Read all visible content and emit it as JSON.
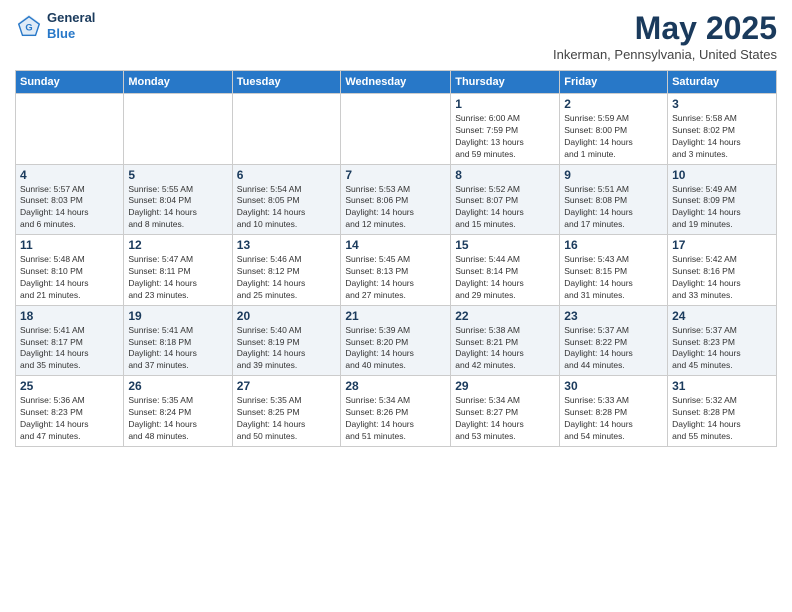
{
  "header": {
    "logo_line1": "General",
    "logo_line2": "Blue",
    "month_title": "May 2025",
    "location": "Inkerman, Pennsylvania, United States"
  },
  "days_of_week": [
    "Sunday",
    "Monday",
    "Tuesday",
    "Wednesday",
    "Thursday",
    "Friday",
    "Saturday"
  ],
  "weeks": [
    [
      {
        "day": "",
        "info": ""
      },
      {
        "day": "",
        "info": ""
      },
      {
        "day": "",
        "info": ""
      },
      {
        "day": "",
        "info": ""
      },
      {
        "day": "1",
        "info": "Sunrise: 6:00 AM\nSunset: 7:59 PM\nDaylight: 13 hours\nand 59 minutes."
      },
      {
        "day": "2",
        "info": "Sunrise: 5:59 AM\nSunset: 8:00 PM\nDaylight: 14 hours\nand 1 minute."
      },
      {
        "day": "3",
        "info": "Sunrise: 5:58 AM\nSunset: 8:02 PM\nDaylight: 14 hours\nand 3 minutes."
      }
    ],
    [
      {
        "day": "4",
        "info": "Sunrise: 5:57 AM\nSunset: 8:03 PM\nDaylight: 14 hours\nand 6 minutes."
      },
      {
        "day": "5",
        "info": "Sunrise: 5:55 AM\nSunset: 8:04 PM\nDaylight: 14 hours\nand 8 minutes."
      },
      {
        "day": "6",
        "info": "Sunrise: 5:54 AM\nSunset: 8:05 PM\nDaylight: 14 hours\nand 10 minutes."
      },
      {
        "day": "7",
        "info": "Sunrise: 5:53 AM\nSunset: 8:06 PM\nDaylight: 14 hours\nand 12 minutes."
      },
      {
        "day": "8",
        "info": "Sunrise: 5:52 AM\nSunset: 8:07 PM\nDaylight: 14 hours\nand 15 minutes."
      },
      {
        "day": "9",
        "info": "Sunrise: 5:51 AM\nSunset: 8:08 PM\nDaylight: 14 hours\nand 17 minutes."
      },
      {
        "day": "10",
        "info": "Sunrise: 5:49 AM\nSunset: 8:09 PM\nDaylight: 14 hours\nand 19 minutes."
      }
    ],
    [
      {
        "day": "11",
        "info": "Sunrise: 5:48 AM\nSunset: 8:10 PM\nDaylight: 14 hours\nand 21 minutes."
      },
      {
        "day": "12",
        "info": "Sunrise: 5:47 AM\nSunset: 8:11 PM\nDaylight: 14 hours\nand 23 minutes."
      },
      {
        "day": "13",
        "info": "Sunrise: 5:46 AM\nSunset: 8:12 PM\nDaylight: 14 hours\nand 25 minutes."
      },
      {
        "day": "14",
        "info": "Sunrise: 5:45 AM\nSunset: 8:13 PM\nDaylight: 14 hours\nand 27 minutes."
      },
      {
        "day": "15",
        "info": "Sunrise: 5:44 AM\nSunset: 8:14 PM\nDaylight: 14 hours\nand 29 minutes."
      },
      {
        "day": "16",
        "info": "Sunrise: 5:43 AM\nSunset: 8:15 PM\nDaylight: 14 hours\nand 31 minutes."
      },
      {
        "day": "17",
        "info": "Sunrise: 5:42 AM\nSunset: 8:16 PM\nDaylight: 14 hours\nand 33 minutes."
      }
    ],
    [
      {
        "day": "18",
        "info": "Sunrise: 5:41 AM\nSunset: 8:17 PM\nDaylight: 14 hours\nand 35 minutes."
      },
      {
        "day": "19",
        "info": "Sunrise: 5:41 AM\nSunset: 8:18 PM\nDaylight: 14 hours\nand 37 minutes."
      },
      {
        "day": "20",
        "info": "Sunrise: 5:40 AM\nSunset: 8:19 PM\nDaylight: 14 hours\nand 39 minutes."
      },
      {
        "day": "21",
        "info": "Sunrise: 5:39 AM\nSunset: 8:20 PM\nDaylight: 14 hours\nand 40 minutes."
      },
      {
        "day": "22",
        "info": "Sunrise: 5:38 AM\nSunset: 8:21 PM\nDaylight: 14 hours\nand 42 minutes."
      },
      {
        "day": "23",
        "info": "Sunrise: 5:37 AM\nSunset: 8:22 PM\nDaylight: 14 hours\nand 44 minutes."
      },
      {
        "day": "24",
        "info": "Sunrise: 5:37 AM\nSunset: 8:23 PM\nDaylight: 14 hours\nand 45 minutes."
      }
    ],
    [
      {
        "day": "25",
        "info": "Sunrise: 5:36 AM\nSunset: 8:23 PM\nDaylight: 14 hours\nand 47 minutes."
      },
      {
        "day": "26",
        "info": "Sunrise: 5:35 AM\nSunset: 8:24 PM\nDaylight: 14 hours\nand 48 minutes."
      },
      {
        "day": "27",
        "info": "Sunrise: 5:35 AM\nSunset: 8:25 PM\nDaylight: 14 hours\nand 50 minutes."
      },
      {
        "day": "28",
        "info": "Sunrise: 5:34 AM\nSunset: 8:26 PM\nDaylight: 14 hours\nand 51 minutes."
      },
      {
        "day": "29",
        "info": "Sunrise: 5:34 AM\nSunset: 8:27 PM\nDaylight: 14 hours\nand 53 minutes."
      },
      {
        "day": "30",
        "info": "Sunrise: 5:33 AM\nSunset: 8:28 PM\nDaylight: 14 hours\nand 54 minutes."
      },
      {
        "day": "31",
        "info": "Sunrise: 5:32 AM\nSunset: 8:28 PM\nDaylight: 14 hours\nand 55 minutes."
      }
    ]
  ]
}
